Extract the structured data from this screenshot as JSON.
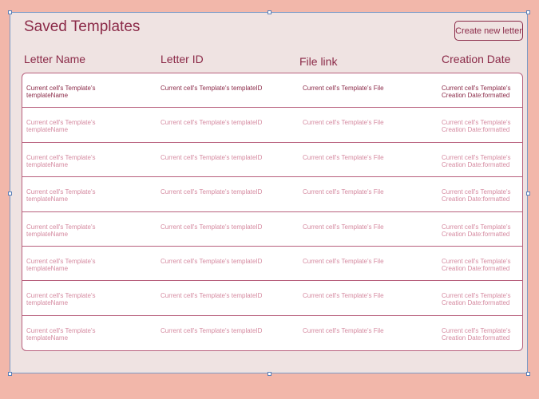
{
  "page": {
    "title": "Saved Templates",
    "create_button_label": "Create new letter"
  },
  "table": {
    "headers": {
      "name": "Letter Name",
      "id": "Letter ID",
      "file": "File link",
      "date": "Creation Date"
    },
    "rows": [
      {
        "name": "Current cell's Template's templateName",
        "id": "Current cell's Template's templateID",
        "file": "Current cell's Template's File",
        "date": "Current cell's Template's Creation Date:formatted"
      },
      {
        "name": "Current cell's Template's templateName",
        "id": "Current cell's Template's templateID",
        "file": "Current cell's Template's File",
        "date": "Current cell's Template's Creation Date:formatted"
      },
      {
        "name": "Current cell's Template's templateName",
        "id": "Current cell's Template's templateID",
        "file": "Current cell's Template's File",
        "date": "Current cell's Template's Creation Date:formatted"
      },
      {
        "name": "Current cell's Template's templateName",
        "id": "Current cell's Template's templateID",
        "file": "Current cell's Template's File",
        "date": "Current cell's Template's Creation Date:formatted"
      },
      {
        "name": "Current cell's Template's templateName",
        "id": "Current cell's Template's templateID",
        "file": "Current cell's Template's File",
        "date": "Current cell's Template's Creation Date:formatted"
      },
      {
        "name": "Current cell's Template's templateName",
        "id": "Current cell's Template's templateID",
        "file": "Current cell's Template's File",
        "date": "Current cell's Template's Creation Date:formatted"
      },
      {
        "name": "Current cell's Template's templateName",
        "id": "Current cell's Template's templateID",
        "file": "Current cell's Template's File",
        "date": "Current cell's Template's Creation Date:formatted"
      },
      {
        "name": "Current cell's Template's templateName",
        "id": "Current cell's Template's templateID",
        "file": "Current cell's Template's File",
        "date": "Current cell's Template's Creation Date:formatted"
      }
    ]
  },
  "colors": {
    "accent": "#8b2a48",
    "row_text_faded": "#d58aa0",
    "border": "#b8607d",
    "panel_bg": "#efe3e2",
    "page_bg": "#f2b7aa"
  }
}
